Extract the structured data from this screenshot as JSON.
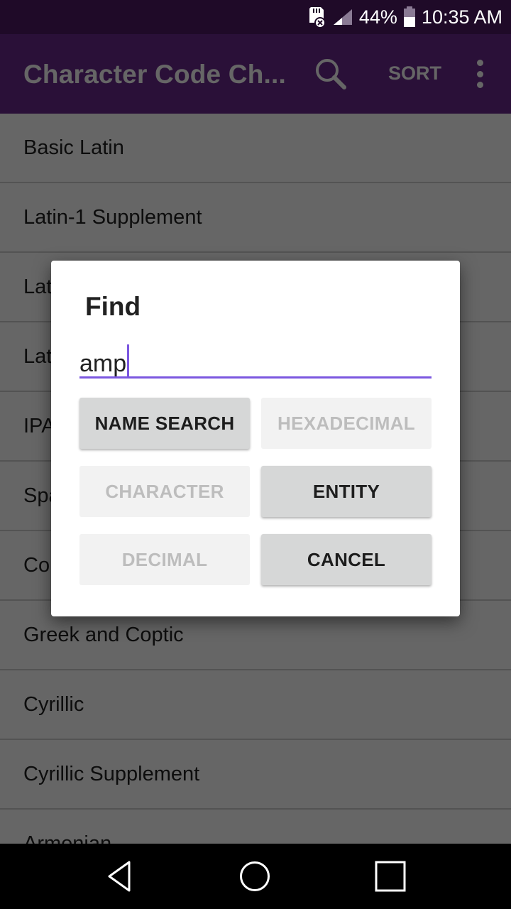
{
  "status_bar": {
    "battery_percent": "44%",
    "time": "10:35 AM",
    "icons": [
      "sd-card-error-icon",
      "signal-icon",
      "battery-icon"
    ]
  },
  "app_bar": {
    "title": "Character Code Ch...",
    "search_icon": "search-icon",
    "sort_label": "SORT",
    "overflow_icon": "more-vert-icon"
  },
  "list": {
    "items": [
      {
        "label": "Basic Latin"
      },
      {
        "label": "Latin-1 Supplement"
      },
      {
        "label": "Latin Extended-A"
      },
      {
        "label": "Latin Extended-B"
      },
      {
        "label": "IPA Extensions"
      },
      {
        "label": "Spacing Modifier Letters"
      },
      {
        "label": "Combining Diacritical Marks"
      },
      {
        "label": "Greek and Coptic"
      },
      {
        "label": "Cyrillic"
      },
      {
        "label": "Cyrillic Supplement"
      },
      {
        "label": "Armenian"
      }
    ]
  },
  "dialog": {
    "title": "Find",
    "input_value": "amp",
    "accent_color": "#7b57e0",
    "buttons": {
      "name_search": {
        "label": "NAME SEARCH",
        "enabled": true
      },
      "hexadecimal": {
        "label": "HEXADECIMAL",
        "enabled": false
      },
      "character": {
        "label": "CHARACTER",
        "enabled": false
      },
      "entity": {
        "label": "ENTITY",
        "enabled": true
      },
      "decimal": {
        "label": "DECIMAL",
        "enabled": false
      },
      "cancel": {
        "label": "CANCEL",
        "enabled": true
      }
    }
  },
  "nav_bar": {
    "back_icon": "back-icon",
    "home_icon": "home-icon",
    "recents_icon": "recents-icon"
  }
}
